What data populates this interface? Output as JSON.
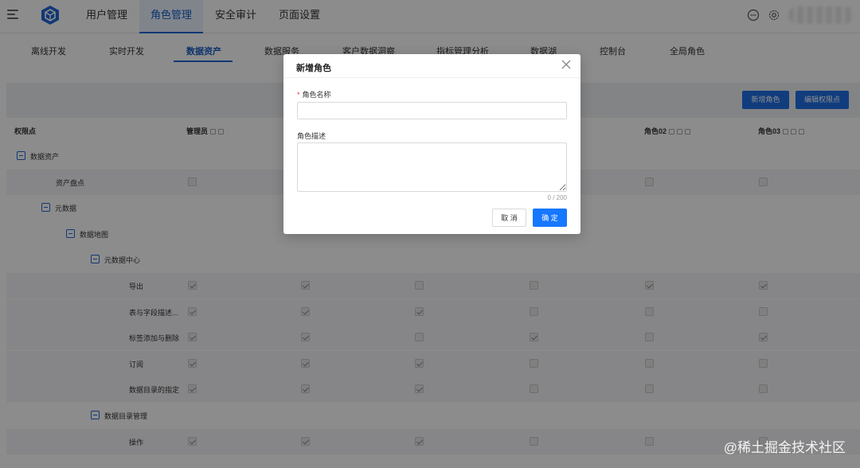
{
  "header": {
    "nav": [
      "用户管理",
      "角色管理",
      "安全审计",
      "页面设置"
    ],
    "active_nav": 1
  },
  "subtabs": [
    "离线开发",
    "实时开发",
    "数据资产",
    "数据服务",
    "客户数据洞察",
    "指标管理分析",
    "数据湖",
    "控制台",
    "全局角色"
  ],
  "active_subtab": 2,
  "toolbar": {
    "new_role": "新增角色",
    "edit_points": "编辑权限点"
  },
  "table": {
    "headers": [
      "权限点",
      "管理员",
      "角色02",
      "角色03"
    ],
    "rows": [
      {
        "label": "数据资产",
        "tree": true,
        "checks": []
      },
      {
        "label": "资产盘点",
        "tree": false,
        "checks": [
          false,
          false,
          false,
          false,
          false,
          false
        ]
      },
      {
        "label": "元数据",
        "tree": true,
        "checks": []
      },
      {
        "label": "数据地图",
        "tree": true,
        "checks": []
      },
      {
        "label": "元数据中心",
        "tree": true,
        "checks": []
      },
      {
        "label": "导出",
        "tree": false,
        "checks": [
          true,
          true,
          false,
          false,
          true,
          true
        ]
      },
      {
        "label": "表与字段描述...",
        "tree": false,
        "checks": [
          true,
          true,
          true,
          false,
          false,
          false
        ]
      },
      {
        "label": "标签添加与删除",
        "tree": false,
        "checks": [
          true,
          true,
          false,
          true,
          false,
          true
        ]
      },
      {
        "label": "订阅",
        "tree": false,
        "checks": [
          true,
          true,
          true,
          false,
          false,
          false
        ]
      },
      {
        "label": "数据目录的指定",
        "tree": false,
        "checks": [
          true,
          true,
          true,
          false,
          false,
          false
        ]
      },
      {
        "label": "数据目录管理",
        "tree": true,
        "checks": []
      },
      {
        "label": "操作",
        "tree": false,
        "checks": [
          true,
          true,
          true,
          false,
          false,
          false
        ]
      }
    ]
  },
  "modal": {
    "title": "新增角色",
    "name_label": "角色名称",
    "name_value": "",
    "desc_label": "角色描述",
    "desc_value": "",
    "counter": "0 / 200",
    "cancel": "取 消",
    "ok": "确 定"
  },
  "watermark": "@稀土掘金技术社区",
  "colors": {
    "primary": "#1f6fe5",
    "mask": "rgba(0,0,0,0.45)"
  }
}
